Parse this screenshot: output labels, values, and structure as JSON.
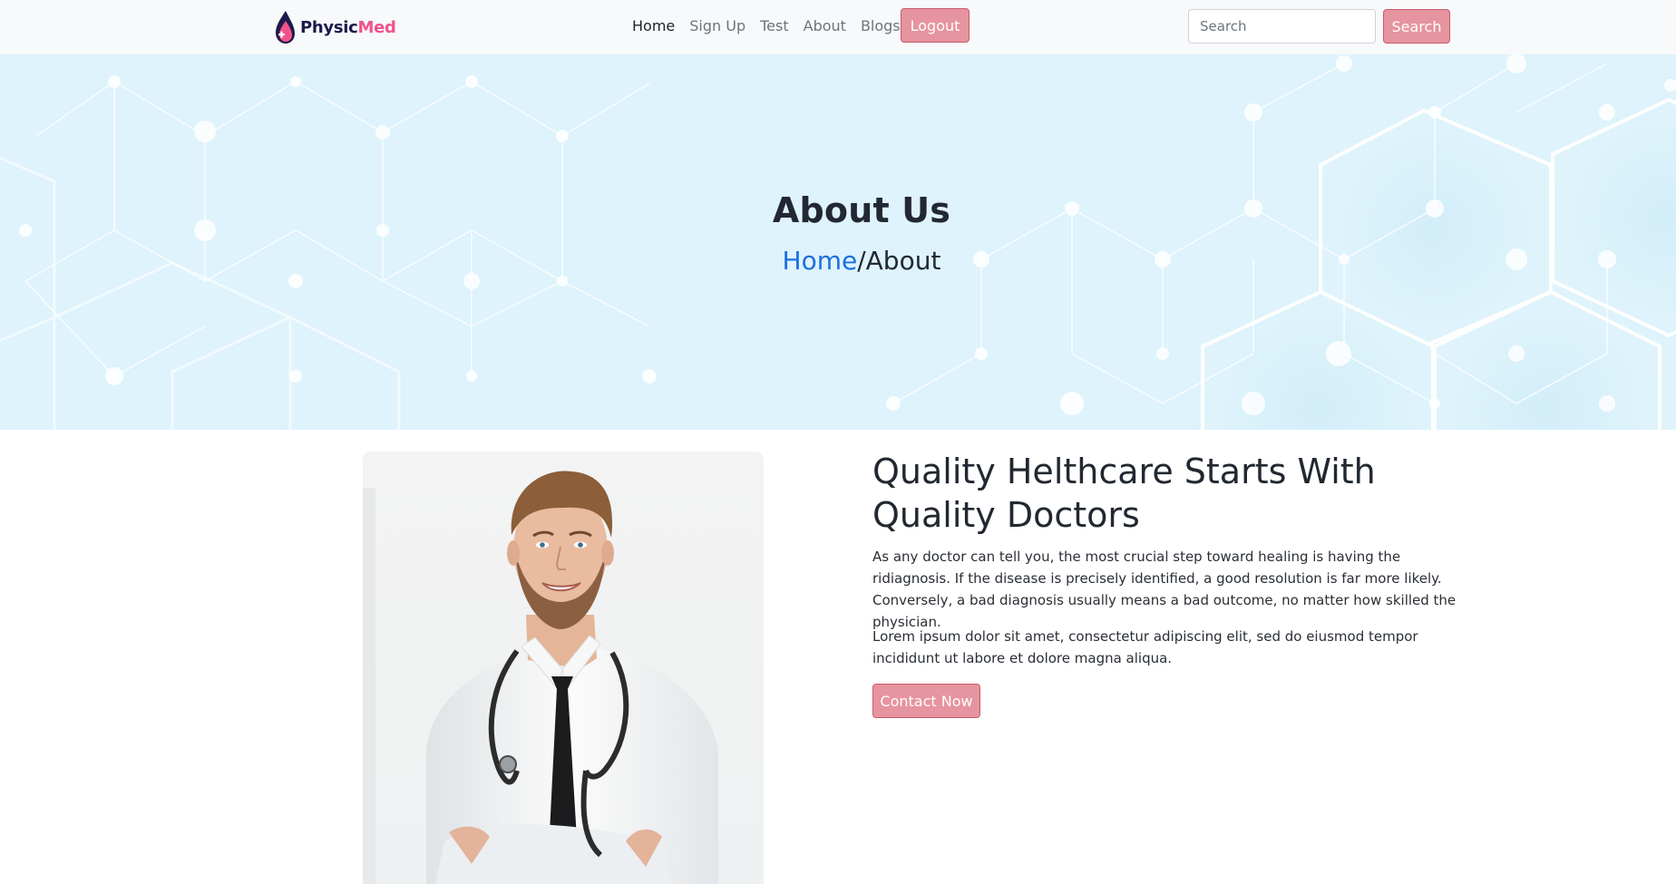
{
  "navbar": {
    "brand": {
      "part1": "Physic",
      "part2": "Med"
    },
    "links": [
      "Home",
      "Sign Up",
      "Test",
      "About",
      "Blogs"
    ],
    "logout_label": "Logout",
    "search_placeholder": "Search",
    "search_button": "Search"
  },
  "hero": {
    "title": "About Us",
    "breadcrumb": {
      "home": "Home",
      "separator": "/",
      "current": "About"
    }
  },
  "content": {
    "title_line1": "Quality Helthcare Starts With",
    "title_line2": "Quality Doctors",
    "paragraph1": "As any doctor can tell you, the most crucial step toward healing is having the ridiagnosis. If the disease is precisely identified, a good resolution is far more likely. Conversely, a bad diagnosis usually means a bad outcome, no matter how skilled the physician.",
    "paragraph2": "Lorem ipsum dolor sit amet, consectetur adipiscing elit, sed do eiusmod tempor incididunt ut labore et dolore magna aliqua.",
    "button_label": "Contact Now"
  },
  "colors": {
    "accent_button": "#e6949f",
    "hero_bg": "#def3fb",
    "link_blue": "#1d6fe0",
    "brand_dark": "#1b1a4a",
    "brand_pink": "#f0528a"
  }
}
